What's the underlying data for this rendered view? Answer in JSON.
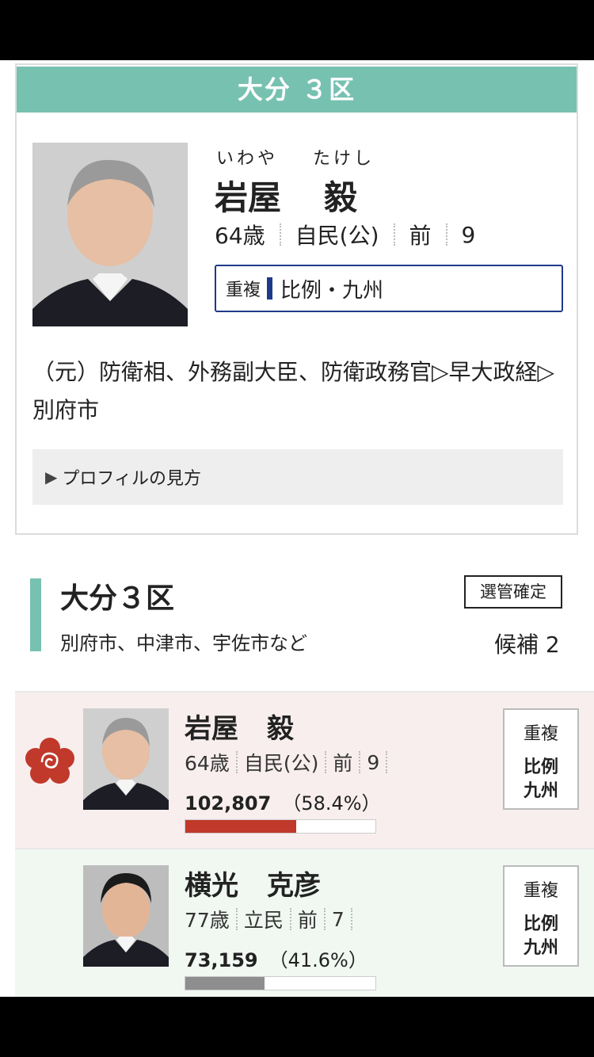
{
  "profile": {
    "header": "大分 ３区",
    "furigana_surname": "いわや",
    "furigana_given": "たけし",
    "surname": "岩屋",
    "given_name": "毅",
    "age": "64歳",
    "party": "自民(公)",
    "status": "前",
    "terms": "9",
    "duplicate_label": "重複",
    "duplicate_value": "比例・九州",
    "career": "（元）防衛相、外務副大臣、防衛政務官▷早大政経▷別府市",
    "help_link": "プロフィルの見方"
  },
  "district": {
    "title": "大分３区",
    "areas": "別府市、中津市、宇佐市など",
    "confirmed_badge": "選管確定",
    "candidate_count": "候補 2"
  },
  "candidates": [
    {
      "surname": "岩屋",
      "given_name": "毅",
      "age": "64歳",
      "party": "自民(公)",
      "status": "前",
      "terms": "9",
      "votes": "102,807",
      "percent": "（58.4%）",
      "share": 0.584,
      "elected": true,
      "bar_color": "#c0392b",
      "dup_label": "重複",
      "dup_line1": "比例",
      "dup_line2": "九州"
    },
    {
      "surname": "横光",
      "given_name": "克彦",
      "age": "77歳",
      "party": "立民",
      "status": "前",
      "terms": "7",
      "votes": "73,159",
      "percent": "（41.6%）",
      "share": 0.416,
      "elected": false,
      "bar_color": "#8e8e8e",
      "dup_label": "重複",
      "dup_line1": "比例",
      "dup_line2": "九州"
    }
  ],
  "colors": {
    "accent": "#77c1b1",
    "duplicate_border": "#1e3a8a",
    "winner_row": "#f9eeee",
    "other_row": "#f1f8f2"
  },
  "icons": {
    "winner": "rose-icon",
    "help": "triangle-right-icon"
  }
}
